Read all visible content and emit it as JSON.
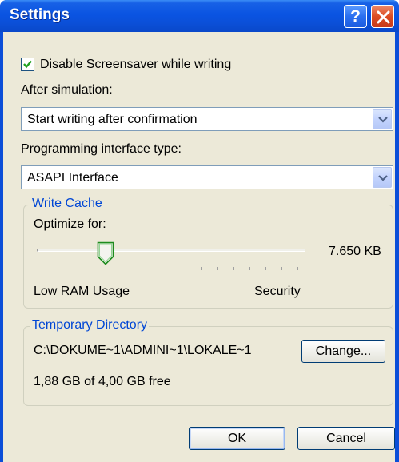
{
  "window": {
    "title": "Settings",
    "help_glyph": "?",
    "close_icon": "close-icon"
  },
  "options": {
    "disable_screensaver": {
      "label": "Disable Screensaver while writing",
      "checked": true
    },
    "after_simulation": {
      "label": "After simulation:",
      "selected": "Start writing after confirmation"
    },
    "programming_interface": {
      "label": "Programming interface type:",
      "selected": "ASAPI Interface"
    }
  },
  "write_cache": {
    "group_title": "Write Cache",
    "optimize_label": "Optimize for:",
    "value_text": "7.650 KB",
    "min_label": "Low RAM Usage",
    "max_label": "Security",
    "tick_count": 17,
    "slider_position_index": 4
  },
  "temp_dir": {
    "group_title": "Temporary Directory",
    "path": "C:\\DOKUME~1\\ADMINI~1\\LOKALE~1",
    "change_button": "Change...",
    "free_space": "1,88 GB of 4,00 GB free"
  },
  "buttons": {
    "ok": "OK",
    "cancel": "Cancel"
  },
  "colors": {
    "titlebar": "#0a54e2",
    "dialog_bg": "#ece9d8",
    "group_title": "#0046d5",
    "close_button": "#dc4c22"
  }
}
